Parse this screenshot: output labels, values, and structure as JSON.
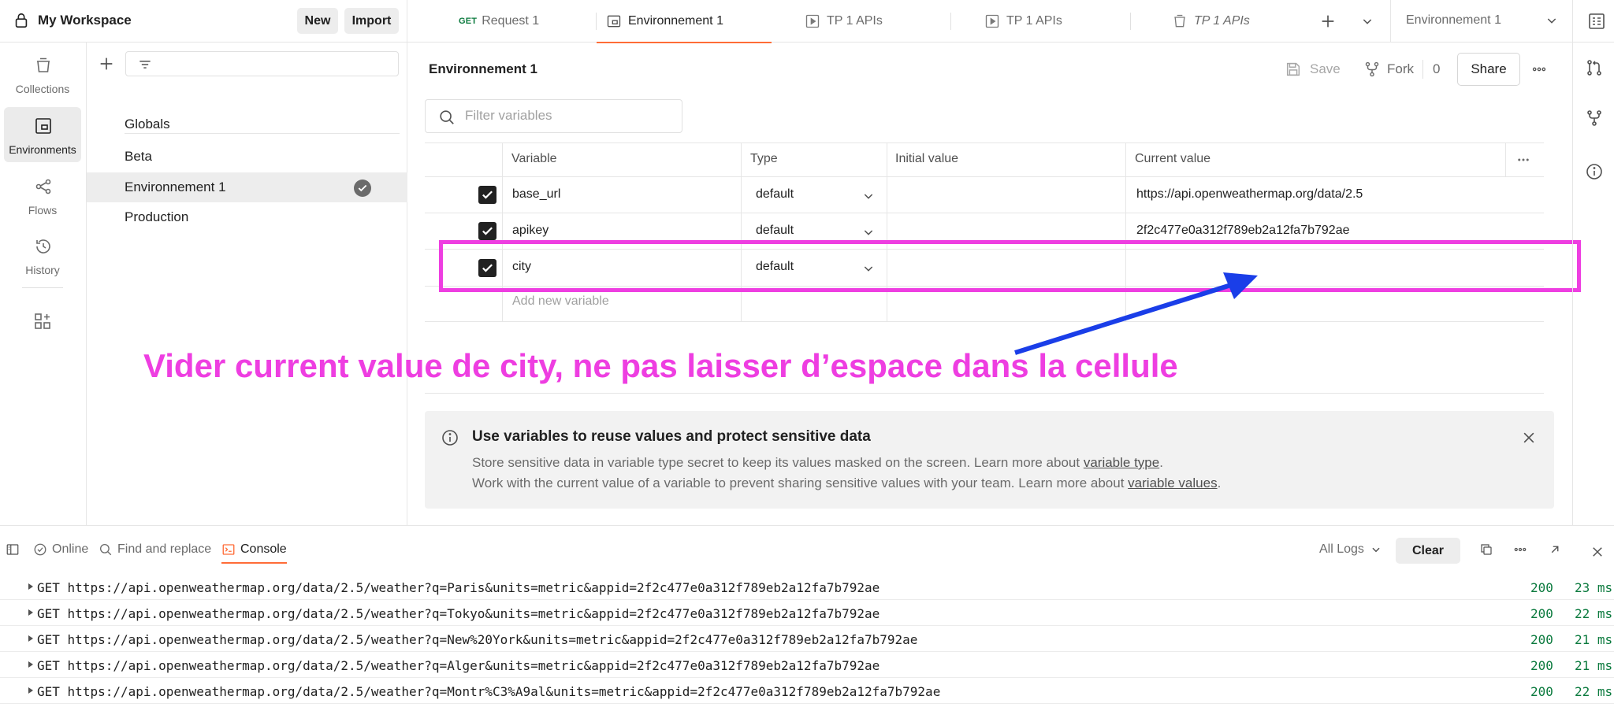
{
  "header": {
    "workspace_title": "My Workspace",
    "new_label": "New",
    "import_label": "Import",
    "tabs": [
      {
        "method": "GET",
        "label": "Request 1",
        "active": false
      },
      {
        "label": "Environnement 1",
        "active": true
      },
      {
        "label": "TP 1 APIs",
        "active": false
      },
      {
        "label": "TP 1 APIs",
        "active": false
      },
      {
        "label": "TP 1 APIs",
        "active": false
      }
    ],
    "env_selector": "Environnement 1"
  },
  "sidebar": {
    "items": [
      {
        "label": "Collections",
        "icon": "collections-icon"
      },
      {
        "label": "Environments",
        "icon": "environments-icon",
        "active": true
      },
      {
        "label": "Flows",
        "icon": "flows-icon"
      },
      {
        "label": "History",
        "icon": "history-icon"
      }
    ]
  },
  "env_list": {
    "globals": "Globals",
    "items": [
      "Beta",
      "Environnement 1",
      "Production"
    ],
    "active": "Environnement 1"
  },
  "main": {
    "title": "Environnement 1",
    "save_label": "Save",
    "fork_label": "Fork",
    "fork_count": "0",
    "share_label": "Share",
    "filter_placeholder": "Filter variables",
    "columns": [
      "Variable",
      "Type",
      "Initial value",
      "Current value"
    ],
    "rows": [
      {
        "variable": "base_url",
        "type": "default",
        "initial": "",
        "current": "https://api.openweathermap.org/data/2.5"
      },
      {
        "variable": "apikey",
        "type": "default",
        "initial": "",
        "current": "2f2c477e0a312f789eb2a12fa7b792ae"
      },
      {
        "variable": "city",
        "type": "default",
        "initial": "",
        "current": ""
      }
    ],
    "add_placeholder": "Add new variable",
    "annotation": "Vider current value de city, ne pas laisser d’espace dans la cellule",
    "annotation_color": "#ee3ee1",
    "arrow_color": "#1a3ee8",
    "banner": {
      "title": "Use variables to reuse values and protect sensitive data",
      "line1_pre": "Store sensitive data in variable type secret to keep its values masked on the screen. Learn more about ",
      "line1_link": "variable type",
      "line1_post": ".",
      "line2_pre": "Work with the current value of a variable to prevent sharing sensitive values with your team. Learn more about ",
      "line2_link": "variable values",
      "line2_post": "."
    }
  },
  "console": {
    "online": "Online",
    "find_replace": "Find and replace",
    "console_label": "Console",
    "all_logs": "All Logs",
    "clear_label": "Clear",
    "logs": [
      {
        "method": "GET",
        "url": "https://api.openweathermap.org/data/2.5/weather?q=Paris&units=metric&appid=2f2c477e0a312f789eb2a12fa7b792ae",
        "status": "200",
        "time": "23 ms"
      },
      {
        "method": "GET",
        "url": "https://api.openweathermap.org/data/2.5/weather?q=Tokyo&units=metric&appid=2f2c477e0a312f789eb2a12fa7b792ae",
        "status": "200",
        "time": "22 ms"
      },
      {
        "method": "GET",
        "url": "https://api.openweathermap.org/data/2.5/weather?q=New%20York&units=metric&appid=2f2c477e0a312f789eb2a12fa7b792ae",
        "status": "200",
        "time": "21 ms"
      },
      {
        "method": "GET",
        "url": "https://api.openweathermap.org/data/2.5/weather?q=Alger&units=metric&appid=2f2c477e0a312f789eb2a12fa7b792ae",
        "status": "200",
        "time": "21 ms"
      },
      {
        "method": "GET",
        "url": "https://api.openweathermap.org/data/2.5/weather?q=Montr%C3%A9al&units=metric&appid=2f2c477e0a312f789eb2a12fa7b792ae",
        "status": "200",
        "time": "22 ms"
      }
    ]
  }
}
